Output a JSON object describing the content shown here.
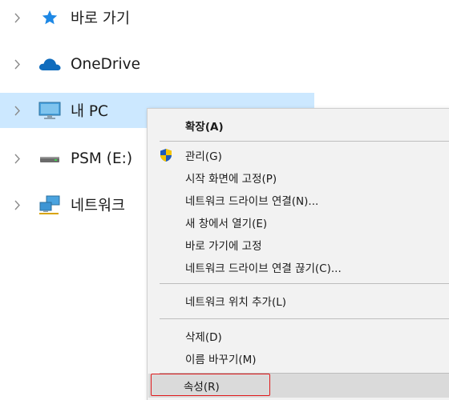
{
  "nav": {
    "items": [
      {
        "label": "바로 가기",
        "icon": "star-icon"
      },
      {
        "label": "OneDrive",
        "icon": "cloud-icon"
      },
      {
        "label": "내 PC",
        "icon": "monitor-icon"
      },
      {
        "label": "PSM (E:)",
        "icon": "drive-icon"
      },
      {
        "label": "네트워크",
        "icon": "network-icon"
      }
    ],
    "selected_index": 2
  },
  "context_menu": {
    "items": [
      {
        "label": "확장(A)",
        "bold": true
      },
      {
        "label": "관리(G)",
        "icon": "shield-icon"
      },
      {
        "label": "시작 화면에 고정(P)"
      },
      {
        "label": "네트워크 드라이브 연결(N)..."
      },
      {
        "label": "새 창에서 열기(E)"
      },
      {
        "label": "바로 가기에 고정"
      },
      {
        "label": "네트워크 드라이브 연결 끊기(C)..."
      },
      {
        "label": "네트워크 위치 추가(L)"
      },
      {
        "label": "삭제(D)"
      },
      {
        "label": "이름 바꾸기(M)"
      },
      {
        "label": "속성(R)",
        "hovered": true
      }
    ]
  },
  "colors": {
    "selection": "#cce8ff",
    "menu_bg": "#f2f2f2",
    "hover": "#dadada",
    "annotation": "#e0191b",
    "star": "#1e88e5",
    "cloud": "#0f6cbd"
  }
}
